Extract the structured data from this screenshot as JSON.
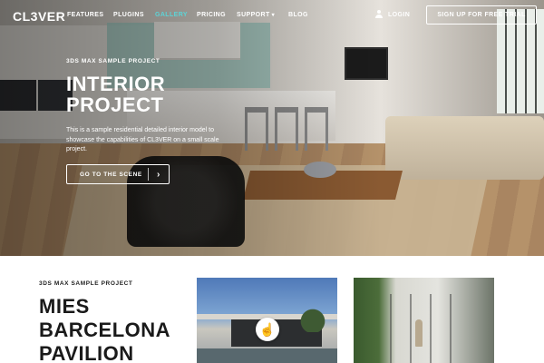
{
  "nav": {
    "logo": "CL3VER",
    "links": [
      {
        "label": "FEATURES"
      },
      {
        "label": "PLUGINS"
      },
      {
        "label": "GALLERY"
      },
      {
        "label": "PRICING"
      },
      {
        "label": "SUPPORT"
      },
      {
        "label": "BLOG"
      }
    ],
    "active_link": "GALLERY",
    "login_label": "LOGIN",
    "signup_label": "SIGN UP FOR FREE TRIAL"
  },
  "hero": {
    "eyebrow": "3DS MAX SAMPLE PROJECT",
    "title": "INTERIOR PROJECT",
    "description": "This is a sample residential detailed interior model to showcase the capabilities of CL3VER on a small scale project.",
    "cta_label": "GO TO THE SCENE",
    "cta_arrow": "›"
  },
  "section2": {
    "eyebrow": "3DS MAX SAMPLE PROJECT",
    "title": "MIES BARCELONA PAVILION"
  },
  "icons": {
    "user": "user-icon",
    "caret": "chevron-down-icon",
    "arrow": "chevron-right-icon",
    "hand": "hand-pointer-icon"
  },
  "colors": {
    "active_nav": "#5dd3d6",
    "text_dark": "#1a1a1a",
    "text_light": "#ffffff"
  }
}
